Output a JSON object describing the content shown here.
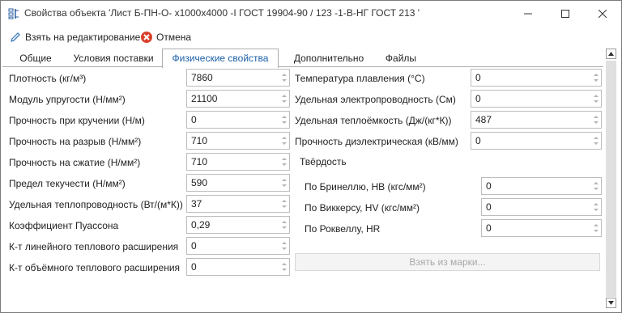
{
  "window": {
    "title": "Свойства объекта 'Лист Б-ПН-О- х1000х4000 -I ГОСТ 19904-90 / 123 -1-В-НГ ГОСТ 213 '"
  },
  "toolbar": {
    "edit_label": "Взять на редактирование",
    "cancel_label": "Отмена"
  },
  "tabs": [
    {
      "label": "Общие"
    },
    {
      "label": "Условия поставки"
    },
    {
      "label": "Физические свойства"
    },
    {
      "label": "Дополнительно"
    },
    {
      "label": "Файлы"
    }
  ],
  "left_fields": [
    {
      "label": "Плотность (кг/м³)",
      "value": "7860"
    },
    {
      "label": "Модуль упругости (Н/мм²)",
      "value": "21100"
    },
    {
      "label": "Прочность при кручении (Н/м)",
      "value": "0"
    },
    {
      "label": "Прочность на разрыв (Н/мм²)",
      "value": "710"
    },
    {
      "label": "Прочность на сжатие (Н/мм²)",
      "value": "710"
    },
    {
      "label": "Предел текучести (Н/мм²)",
      "value": "590"
    },
    {
      "label": "Удельная теплопроводность (Вт/(м*К))",
      "value": "37"
    },
    {
      "label": "Коэффициент Пуассона",
      "value": "0,29"
    },
    {
      "label": "К-т линейного теплового расширения",
      "value": "0"
    },
    {
      "label": "К-т объёмного теплового расширения",
      "value": "0"
    }
  ],
  "right_fields": [
    {
      "label": "Температура плавления (°С)",
      "value": "0"
    },
    {
      "label": "Удельная электропроводность (См)",
      "value": "0"
    },
    {
      "label": "Удельная теплоёмкость (Дж/(кг*К))",
      "value": "487"
    },
    {
      "label": "Прочность диэлектрическая (кВ/мм)",
      "value": "0"
    }
  ],
  "hardness": {
    "title": "Твёрдость",
    "fields": [
      {
        "label": "По Бринеллю, НВ (кгс/мм²)",
        "value": "0"
      },
      {
        "label": "По Виккерсу, HV (кгс/мм²)",
        "value": "0"
      },
      {
        "label": "По Роквеллу, HR",
        "value": "0"
      }
    ]
  },
  "take_from_grade_button": "Взять из марки...",
  "colors": {
    "active_tab": "#1a5fa8",
    "cancel_icon": "#d9412b",
    "edit_icon": "#2b6cb0"
  },
  "icons": [
    "app-icon",
    "minimize-icon",
    "maximize-icon",
    "close-icon",
    "pencil-icon",
    "cancel-icon",
    "spin-up-icon",
    "spin-down-icon",
    "scroll-up-icon",
    "scroll-down-icon"
  ]
}
